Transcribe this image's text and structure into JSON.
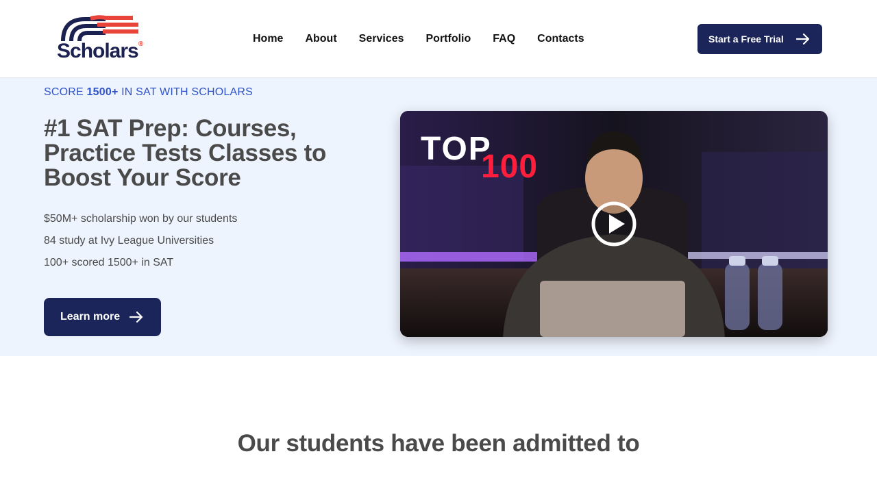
{
  "brand": {
    "name": "Scholars",
    "mark": "®",
    "colors": {
      "navy": "#1b2559",
      "red": "#e8443a",
      "accent_blue": "#2f53c9",
      "hero_bg": "#eef4fe"
    }
  },
  "nav": {
    "items": [
      {
        "label": "Home"
      },
      {
        "label": "About"
      },
      {
        "label": "Services"
      },
      {
        "label": "Portfolio"
      },
      {
        "label": "FAQ"
      },
      {
        "label": "Contacts"
      }
    ],
    "cta": {
      "label": "Start a Free Trial",
      "icon": "arrow-right-icon"
    }
  },
  "hero": {
    "kicker_pre": "SCORE ",
    "kicker_bold": "1500+",
    "kicker_post": " IN SAT WITH SCHOLARS",
    "headline": "#1 SAT Prep: Courses, Practice Tests Classes to Boost Your Score",
    "stats": [
      "$50M+ scholarship won by our students",
      "84 study at Ivy League Universities",
      "100+ scored 1500+ in SAT"
    ],
    "button": {
      "label": "Learn more",
      "icon": "arrow-right-icon"
    },
    "video": {
      "overlay_line1": "TOP",
      "overlay_line2": "100",
      "play_icon": "play-icon"
    }
  },
  "admitted": {
    "title": "Our students have been admitted to"
  }
}
